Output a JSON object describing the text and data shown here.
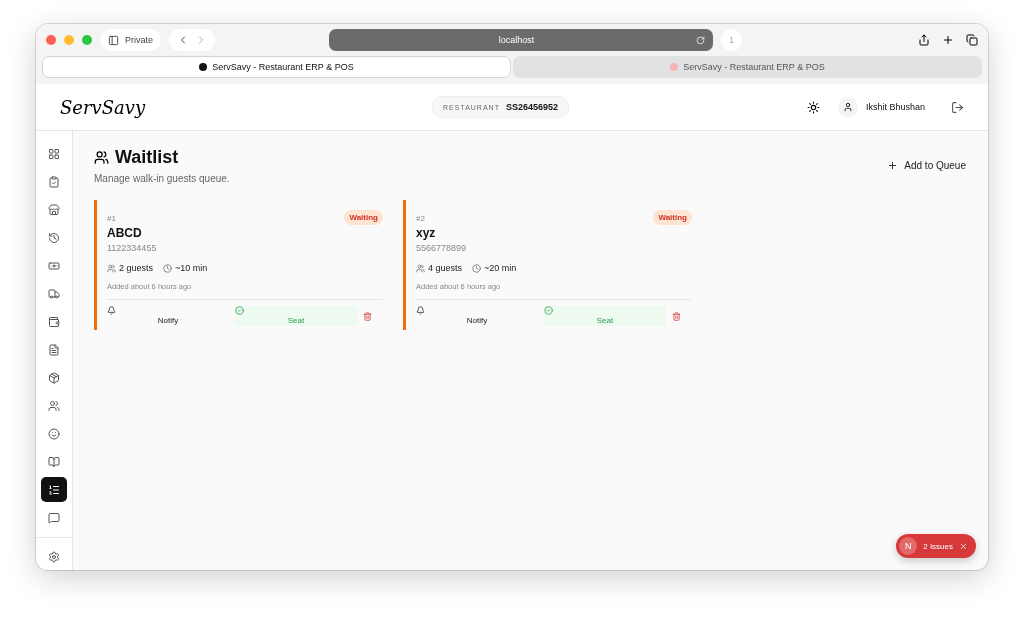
{
  "browser": {
    "private_label": "Private",
    "url": "localhost",
    "shield_count": "1",
    "tabs": [
      {
        "title": "ServSavy - Restaurant ERP & POS",
        "selected": true
      },
      {
        "title": "ServSavy - Restaurant ERP & POS",
        "selected": false
      }
    ]
  },
  "header": {
    "logo": "ServSavy",
    "restaurant_label": "RESTAURANT",
    "restaurant_code": "SS26456952",
    "user_name": "Ikshit Bhushan"
  },
  "sidebar": {
    "items": [
      {
        "selected": false
      },
      {
        "selected": false
      },
      {
        "selected": false
      },
      {
        "selected": false
      },
      {
        "selected": false
      },
      {
        "selected": false
      },
      {
        "selected": false
      },
      {
        "selected": false
      },
      {
        "selected": false
      },
      {
        "selected": false
      },
      {
        "selected": false
      },
      {
        "selected": false
      },
      {
        "selected": true
      },
      {
        "selected": false
      }
    ]
  },
  "page": {
    "title": "Waitlist",
    "subtitle": "Manage walk-in guests queue.",
    "add_button": "Add to Queue"
  },
  "entries": [
    {
      "number": "#1",
      "name": "ABCD",
      "phone": "1122334455",
      "guests": "2 guests",
      "wait": "~10 min",
      "added": "Added about 6 hours ago",
      "status": "Waiting",
      "notify": "Notify",
      "seat": "Seat"
    },
    {
      "number": "#2",
      "name": "xyz",
      "phone": "5566778899",
      "guests": "4 guests",
      "wait": "~20 min",
      "added": "Added about 6 hours ago",
      "status": "Waiting",
      "notify": "Notify",
      "seat": "Seat"
    }
  ],
  "issues": {
    "logo": "N",
    "label": "2 Issues"
  }
}
